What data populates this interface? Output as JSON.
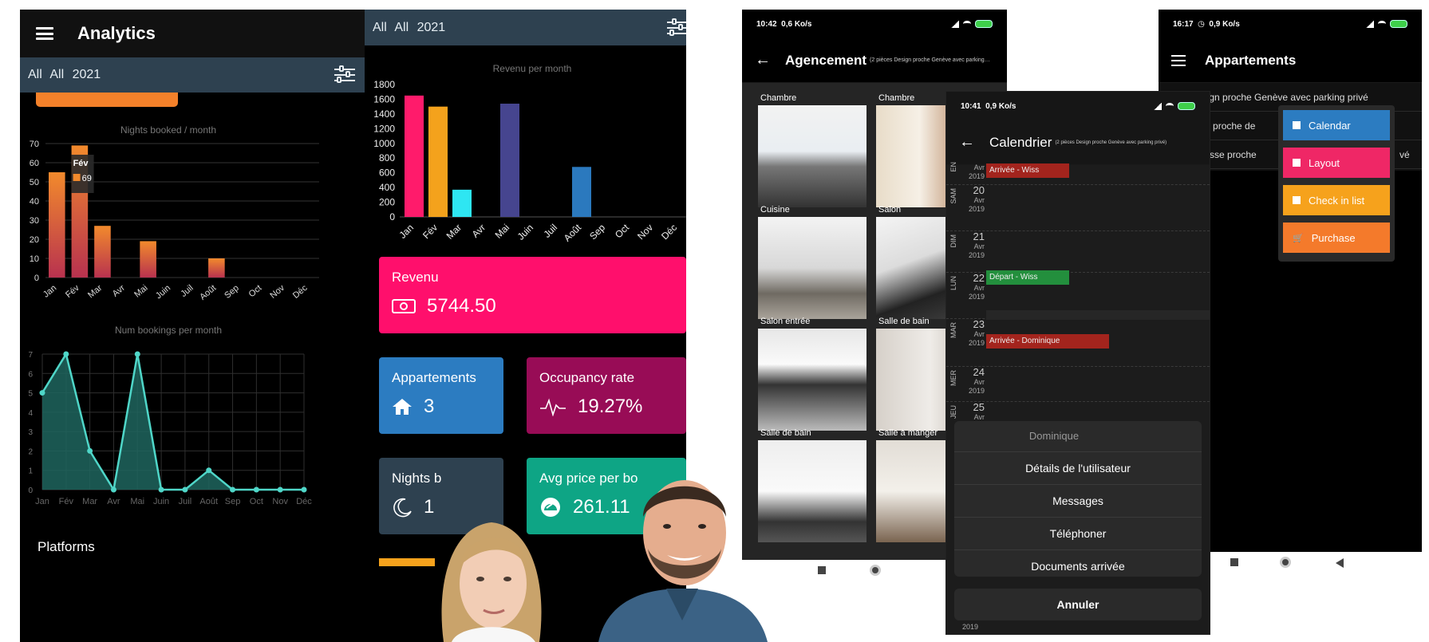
{
  "analytics": {
    "title": "Analytics",
    "filter": [
      "All",
      "All",
      "2021"
    ]
  },
  "chart_data": [
    {
      "type": "bar",
      "title": "Nights booked / month",
      "categories": [
        "Jan",
        "Fév",
        "Mar",
        "Avr",
        "Mai",
        "Juin",
        "Juil",
        "Août",
        "Sep",
        "Oct",
        "Nov",
        "Déc"
      ],
      "values": [
        55,
        69,
        27,
        0,
        19,
        0,
        0,
        10,
        0,
        0,
        0,
        0
      ],
      "yticks": [
        0,
        10,
        20,
        30,
        40,
        50,
        60,
        70
      ],
      "ylim": [
        0,
        70
      ],
      "tooltip": {
        "title": "Fév",
        "value": "69"
      }
    },
    {
      "type": "area",
      "title": "Num bookings per month",
      "categories": [
        "Jan",
        "Fév",
        "Mar",
        "Avr",
        "Mai",
        "Juin",
        "Juil",
        "Août",
        "Sep",
        "Oct",
        "Nov",
        "Déc"
      ],
      "values": [
        5,
        7,
        2,
        0,
        7,
        0,
        0,
        1,
        0,
        0,
        0,
        0
      ],
      "yticks": [
        0,
        1,
        2,
        3,
        4,
        5,
        6,
        7
      ],
      "ylim": [
        0,
        7
      ]
    },
    {
      "type": "bar",
      "title": "Revenu per month",
      "categories": [
        "Jan",
        "Fév",
        "Mar",
        "Avr",
        "Mai",
        "Juin",
        "Juil",
        "Août",
        "Sep",
        "Oct",
        "Nov",
        "Déc"
      ],
      "values": [
        1650,
        1500,
        370,
        0,
        1540,
        0,
        0,
        680,
        0,
        0,
        0,
        0
      ],
      "colors": [
        "#ff1b6b",
        "#f4a21c",
        "#2ee6f2",
        "#000000",
        "#46458f",
        "#000000",
        "#000000",
        "#2b79be",
        "#000000",
        "#000000",
        "#000000",
        "#000000"
      ],
      "yticks": [
        0,
        200,
        400,
        600,
        800,
        1000,
        1200,
        1400,
        1600,
        1800
      ],
      "ylim": [
        0,
        1800
      ]
    }
  ],
  "platforms_label": "Platforms",
  "revenue_filter": [
    "All",
    "All",
    "2021"
  ],
  "cards": {
    "revenu": {
      "label": "Revenu",
      "value": "5744.50",
      "color": "#ff0f6c"
    },
    "appartements": {
      "label": "Appartements",
      "value": "3",
      "color": "#2c7cc1"
    },
    "occupancy": {
      "label": "Occupancy rate",
      "value": "19.27%",
      "color": "#980c56"
    },
    "nights": {
      "label": "Nights b",
      "value": "1",
      "color": "#2e4150"
    },
    "avgprice": {
      "label": "Avg price per bo",
      "value": "261.11",
      "color": "#0ea585"
    }
  },
  "agencement": {
    "time": "10:42",
    "speed": "0,6 Ko/s",
    "title": "Agencement",
    "subtitle": "(2 pièces Design proche Genève avec parking…",
    "rooms": [
      "Chambre",
      "Chambre",
      "Cuisine",
      "Salon",
      "Salon entrée",
      "Salle de bain",
      "Salle de bain",
      "Salle à manger"
    ]
  },
  "calendrier": {
    "time": "10:41",
    "speed": "0,9 Ko/s",
    "title": "Calendrier",
    "subtitle": "(2 pièces Design proche Genève avec parking privé)",
    "days": [
      {
        "dw": "SAM",
        "d": "20",
        "m": "Avr",
        "y": "2019"
      },
      {
        "dw": "DIM",
        "d": "21",
        "m": "Avr",
        "y": "2019"
      },
      {
        "dw": "LUN",
        "d": "22",
        "m": "Avr",
        "y": "2019"
      },
      {
        "dw": "MAR",
        "d": "23",
        "m": "Avr",
        "y": "2019"
      },
      {
        "dw": "MER",
        "d": "24",
        "m": "Avr",
        "y": "2019"
      },
      {
        "dw": "JEU",
        "d": "25",
        "m": "Avr",
        "y": "2019"
      }
    ],
    "top_partial": {
      "dw": "EN",
      "m": "Avr",
      "y": "2019"
    },
    "events": [
      "Arrivée - Wiss",
      "Départ - Wiss",
      "Arrivée - Dominique"
    ],
    "sheet": {
      "header": "Dominique",
      "items": [
        "Détails de l'utilisateur",
        "Messages",
        "Téléphoner",
        "Documents arrivée"
      ],
      "cancel": "Annuler"
    },
    "bottom_year": "2019"
  },
  "appartements": {
    "time": "16:17",
    "speed": "0,9 Ko/s",
    "title": "Appartements",
    "items": [
      "s Design proche Genève avec parking privé",
      "pièces proche de",
      "s terrasse proche"
    ],
    "item3_tail": "vé",
    "menu": [
      {
        "label": "Calendar",
        "color": "#2c7cc1"
      },
      {
        "label": "Layout",
        "color": "#ef2766"
      },
      {
        "label": "Check in list",
        "color": "#f6a21c"
      },
      {
        "label": "Purchase",
        "color": "#f47a2b"
      }
    ]
  }
}
